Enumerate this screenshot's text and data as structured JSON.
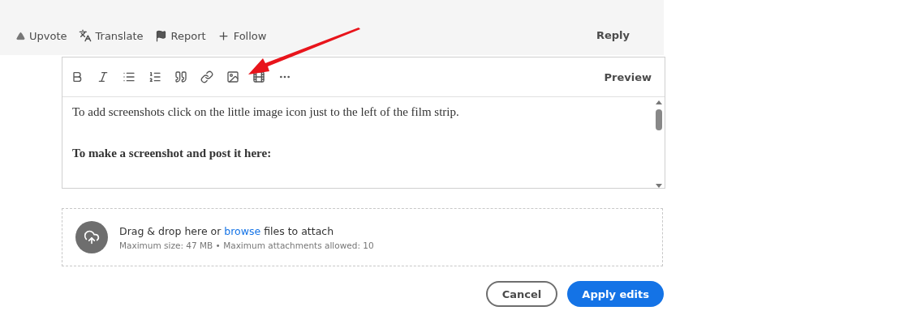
{
  "actions": [
    {
      "kind": "upvote",
      "label": "Upvote"
    },
    {
      "kind": "translate",
      "label": "Translate"
    },
    {
      "kind": "report",
      "label": "Report"
    },
    {
      "kind": "follow",
      "label": "Follow"
    }
  ],
  "reply": "Reply",
  "toolbar": {
    "tools": [
      {
        "kind": "bold"
      },
      {
        "kind": "italic"
      },
      {
        "kind": "bullets"
      },
      {
        "kind": "numbers"
      },
      {
        "kind": "quote"
      },
      {
        "kind": "link"
      },
      {
        "kind": "image"
      },
      {
        "kind": "video"
      },
      {
        "kind": "more"
      }
    ],
    "preview": "Preview"
  },
  "editor": {
    "paragraphs": [
      {
        "kind": "plain",
        "text": "To add screenshots click on the little image icon just to the left of the film strip."
      },
      {
        "kind": "bold",
        "text": "To make a screenshot and post it here:"
      }
    ]
  },
  "attach": {
    "before": "Drag & drop here or ",
    "link": "browse",
    "after": " files to attach",
    "note": "Maximum size: 47 MB • Maximum attachments allowed: 10"
  },
  "buttons": {
    "cancel": "Cancel",
    "apply": "Apply edits"
  }
}
